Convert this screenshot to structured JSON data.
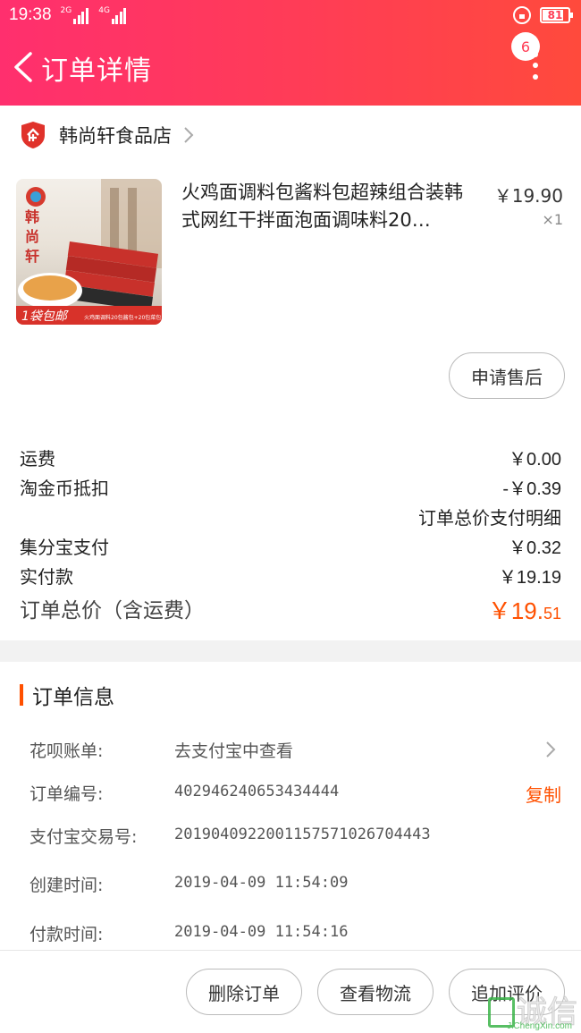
{
  "status_bar": {
    "time": "19:38",
    "net1": "2G",
    "net2": "4G",
    "battery": "81"
  },
  "nav": {
    "title": "订单详情",
    "badge_count": "6"
  },
  "shop": {
    "name": "韩尚轩食品店"
  },
  "product": {
    "title": "火鸡面调料包酱料包超辣组合装韩式网红干拌面泡面调味料20…",
    "price": "￥19.90",
    "qty": "×1",
    "image_brand": "韩尚轩",
    "image_badge": "1袋包邮",
    "image_caption": "火鸡面调料20包酱包+20包菜包"
  },
  "after_sale_label": "申请售后",
  "summary": {
    "shipping_label": "运费",
    "shipping_value": "￥0.00",
    "coin_label": "淘金币抵扣",
    "coin_value": "-￥0.39",
    "detail_link": "订单总价支付明细",
    "jifen_label": "集分宝支付",
    "jifen_value": "￥0.32",
    "paid_label": "实付款",
    "paid_value": "￥19.19",
    "total_label": "订单总价（含运费）",
    "total_main": "￥19.",
    "total_decimal": "51"
  },
  "order_info": {
    "title": "订单信息",
    "huabei_label": "花呗账单:",
    "huabei_value": "去支付宝中查看",
    "order_no_label": "订单编号:",
    "order_no_value": "402946240653434444",
    "copy_label": "复制",
    "alipay_label": "支付宝交易号:",
    "alipay_value": "2019040922001157571026704443",
    "created_label": "创建时间:",
    "created_value": "2019-04-09 11:54:09",
    "paid_time_label": "付款时间:",
    "paid_time_value": "2019-04-09 11:54:16"
  },
  "actions": {
    "delete": "删除订单",
    "logistics": "查看物流",
    "review": "追加评价"
  },
  "watermark": {
    "text": "诚信",
    "sub": "JiChengXin.com"
  },
  "colors": {
    "header_start": "#ff2f6e",
    "header_end": "#ff4a3c",
    "accent_orange": "#ff5000"
  }
}
